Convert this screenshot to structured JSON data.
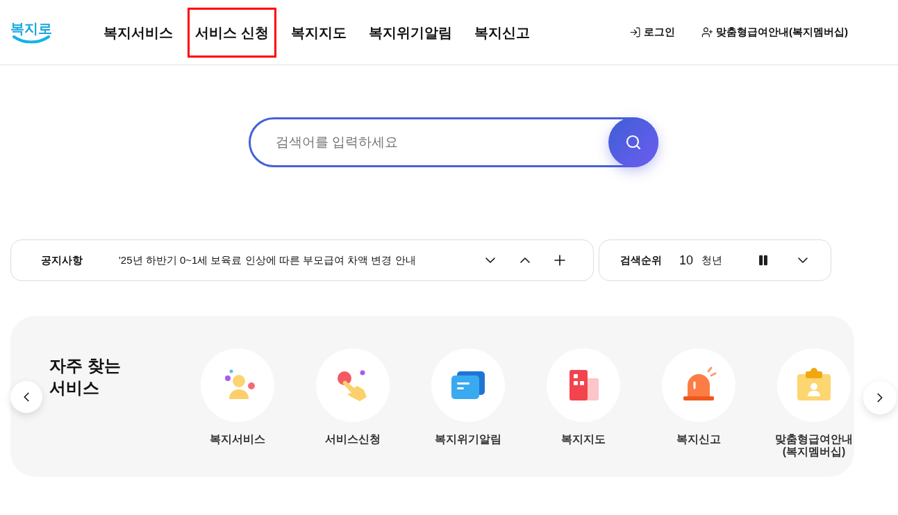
{
  "header": {
    "logo": "복지로",
    "nav": [
      {
        "label": "복지서비스",
        "highlighted": false
      },
      {
        "label": "서비스 신청",
        "highlighted": true
      },
      {
        "label": "복지지도",
        "highlighted": false
      },
      {
        "label": "복지위기알림",
        "highlighted": false
      },
      {
        "label": "복지신고",
        "highlighted": false
      }
    ],
    "login": "로그인",
    "membership": "맞춤형급여안내(복지멤버십)"
  },
  "search": {
    "placeholder": "검색어를 입력하세요"
  },
  "notice": {
    "label": "공지사항",
    "text": "'25년 하반기 0~1세 보육료 인상에 따른 부모급여 차액 변경 안내"
  },
  "ranking": {
    "label": "검색순위",
    "rank": "10",
    "keyword": "청년"
  },
  "frequent": {
    "title": "자주 찾는 서비스",
    "services": [
      {
        "kind": "person",
        "label": "복지서비스"
      },
      {
        "kind": "hand",
        "label": "서비스신청"
      },
      {
        "kind": "message",
        "label": "복지위기알림"
      },
      {
        "kind": "building",
        "label": "복지지도"
      },
      {
        "kind": "siren",
        "label": "복지신고"
      },
      {
        "kind": "badge",
        "label": "맞춤형급여안내",
        "label2": "(복지멤버십)"
      }
    ]
  }
}
